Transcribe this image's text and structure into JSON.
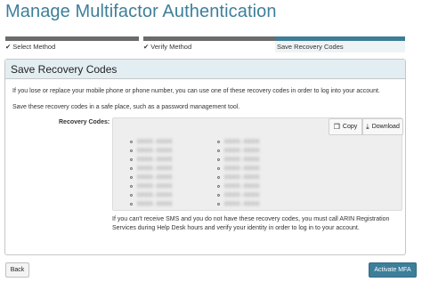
{
  "page": {
    "title": "Manage Multifactor Authentication"
  },
  "steps": [
    {
      "label": "Select Method",
      "status": "complete"
    },
    {
      "label": "Verify Method",
      "status": "complete"
    },
    {
      "label": "Save Recovery Codes",
      "status": "current"
    }
  ],
  "colors": {
    "accent": "#3d7f9a",
    "step_done": "#6b6b6b",
    "panel_header": "#e3eef3"
  },
  "panel": {
    "title": "Save Recovery Codes",
    "intro": "If you lose or replace your mobile phone or phone number, you can use one of these recovery codes in order to log into your account.",
    "safe_place": "Save these recovery codes in a safe place, such as a password management tool.",
    "codes_label": "Recovery Codes:",
    "copy_label": "Copy",
    "download_label": "Download",
    "codes_left": [
      "XXXX-XXXX",
      "XXXX-XXXX",
      "XXXX-XXXX",
      "XXXX-XXXX",
      "XXXX-XXXX",
      "XXXX-XXXX",
      "XXXX-XXXX",
      "XXXX-XXXX"
    ],
    "codes_right": [
      "XXXX-XXXX",
      "XXXX-XXXX",
      "XXXX-XXXX",
      "XXXX-XXXX",
      "XXXX-XXXX",
      "XXXX-XXXX",
      "XXXX-XXXX",
      "XXXX-XXXX"
    ],
    "warning": "If you can't receive SMS and you do not have these recovery codes, you must call ARIN Registration Services during Help Desk hours and verify your identity in order to log in to your account."
  },
  "footer": {
    "back_label": "Back",
    "activate_label": "Activate MFA"
  }
}
